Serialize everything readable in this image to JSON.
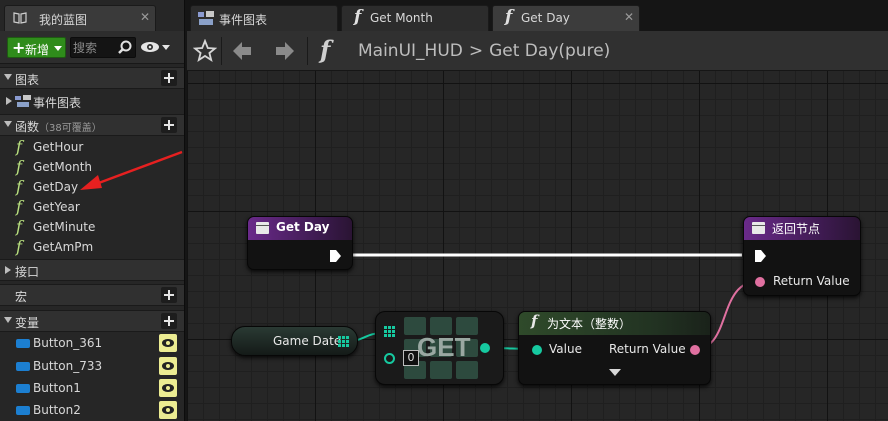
{
  "left_panel": {
    "tab_title": "我的蓝图",
    "new_button": "新增",
    "search_placeholder": "搜索",
    "sections": {
      "graphs": "图表",
      "event_graph": "事件图表",
      "functions": "函数",
      "functions_sub": "（38可覆盖）",
      "interfaces": "接口",
      "macros": "宏",
      "variables": "变量"
    },
    "functions": [
      "GetHour",
      "GetMonth",
      "GetDay",
      "GetYear",
      "GetMinute",
      "GetAmPm"
    ],
    "variables": [
      "Button_361",
      "Button_733",
      "Button1",
      "Button2"
    ]
  },
  "tabs": [
    "事件图表",
    "Get Month",
    "Get Day"
  ],
  "breadcrumb": {
    "blueprint": "MainUI_HUD",
    "separator": ">",
    "function": "Get Day(pure)"
  },
  "nodes": {
    "entry": {
      "title": "Get Day"
    },
    "return": {
      "title": "返回节点",
      "pin": "Return Value"
    },
    "var": {
      "label": "Game Date"
    },
    "get": {
      "label": "GET",
      "index": "0"
    },
    "totext": {
      "title": "为文本（整数）",
      "in_pin": "Value",
      "out_pin": "Return Value"
    }
  },
  "colors": {
    "function_icon": "#b8e07e",
    "new_button": "#2f8c1b",
    "entry_header": "#6a2a8a",
    "return_header": "#6a2a8a",
    "totext_header": "#2f4a2a",
    "struct_pin": "#16c9a0",
    "text_pin": "#e070a0",
    "annotation_arrow": "#e62020"
  }
}
